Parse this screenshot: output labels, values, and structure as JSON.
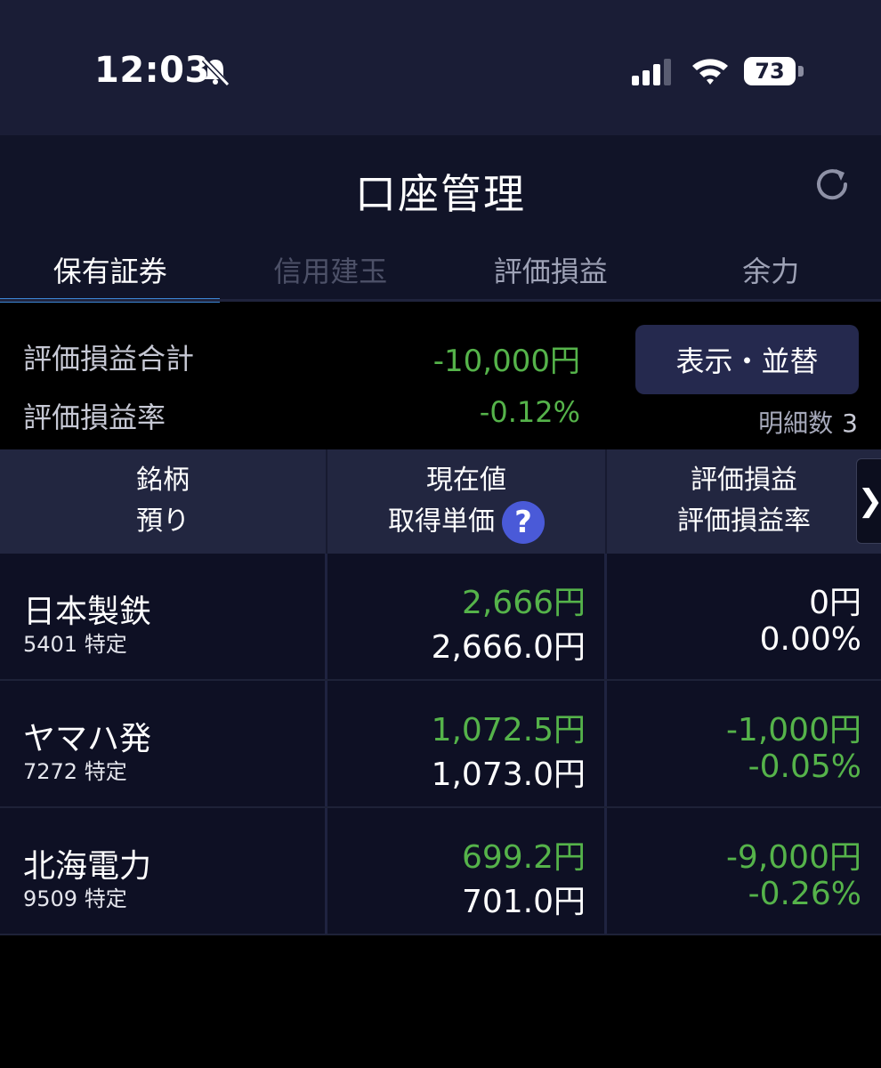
{
  "status_bar": {
    "time": "12:03",
    "battery": "73"
  },
  "header": {
    "title": "口座管理"
  },
  "tabs": [
    {
      "label": "保有証券",
      "state": "active"
    },
    {
      "label": "信用建玉",
      "state": "disabled"
    },
    {
      "label": "評価損益",
      "state": "normal"
    },
    {
      "label": "余力",
      "state": "normal"
    }
  ],
  "summary": {
    "total_pl_label": "評価損益合計",
    "total_pl_value": "-10,000円",
    "pl_rate_label": "評価損益率",
    "pl_rate_value": "-0.12%",
    "display_button": "表示・並替",
    "detail_count_label": "明細数",
    "detail_count": "3"
  },
  "table": {
    "headers": {
      "col1_line1": "銘柄",
      "col1_line2": "預り",
      "col2_line1": "現在値",
      "col2_line2": "取得単価",
      "help": "?",
      "col3_line1": "評価損益",
      "col3_line2": "評価損益率",
      "scroll": "❯"
    },
    "rows": [
      {
        "name": "日本製鉄",
        "code": "5401 特定",
        "price": "2,666円",
        "cost": "2,666.0円",
        "pl": "0円",
        "pl_rate": "0.00%"
      },
      {
        "name": "ヤマハ発",
        "code": "7272 特定",
        "price": "1,072.5円",
        "cost": "1,073.0円",
        "pl": "-1,000円",
        "pl_rate": "-0.05%"
      },
      {
        "name": "北海電力",
        "code": "9509 特定",
        "price": "699.2円",
        "cost": "701.0円",
        "pl": "-9,000円",
        "pl_rate": "-0.26%"
      }
    ]
  },
  "colors": {
    "positive_zero": "#ffffff",
    "negative": "#55b34a",
    "tab_underline": "#3d86d6"
  }
}
